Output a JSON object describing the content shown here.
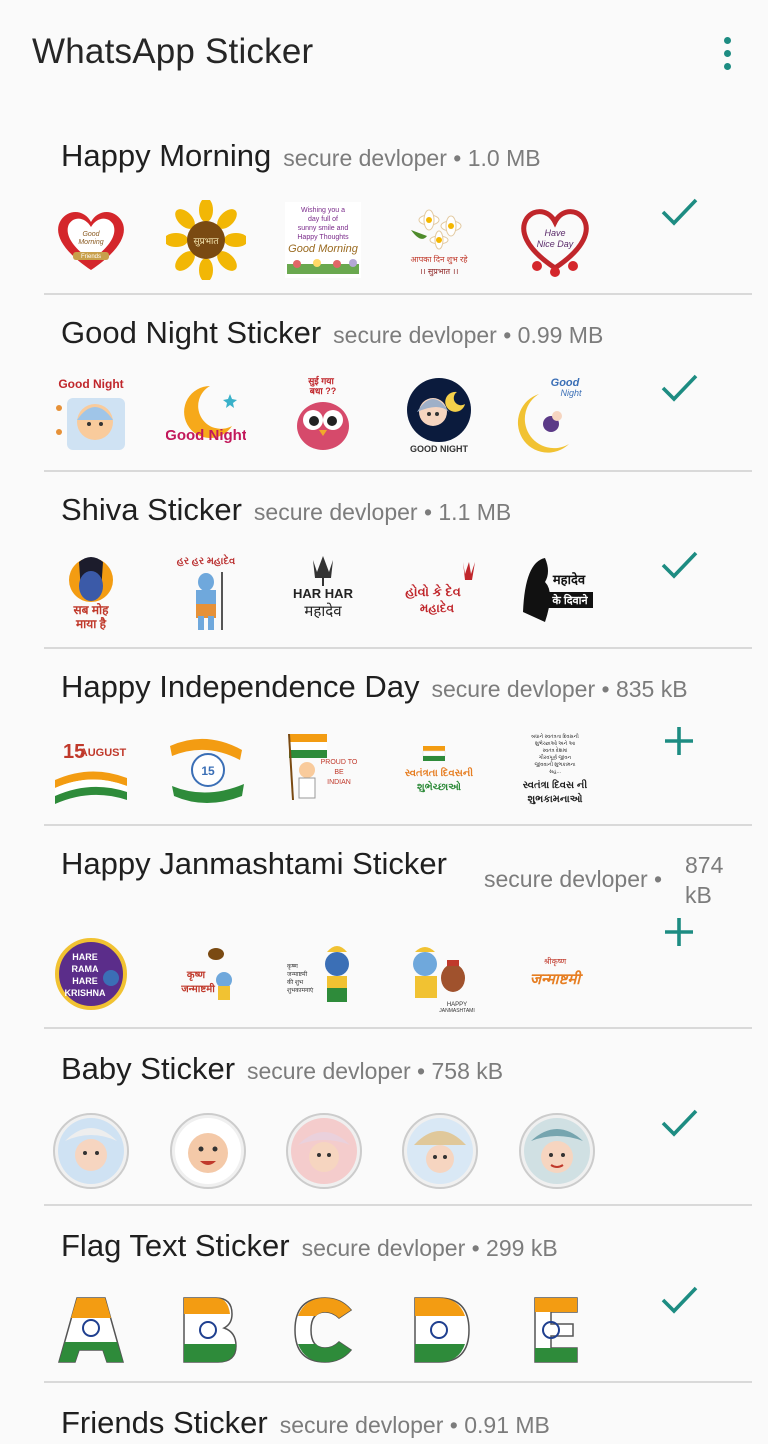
{
  "app": {
    "title": "WhatsApp Sticker"
  },
  "colors": {
    "accent": "#1d8c82",
    "divider": "#d9d9d9",
    "meta_text": "#7c7c7c"
  },
  "packs": [
    {
      "name": "Happy Morning",
      "meta": "secure devloper • 1.0 MB",
      "action": "added",
      "stickers": [
        {
          "icon": "heart-good-morning-sticker",
          "text": "Good Morning Friends"
        },
        {
          "icon": "sunflower-sticker",
          "text": "सुप्रभात"
        },
        {
          "icon": "wishing-text-sticker",
          "text": "Wishing you a day full of sunny smile and Happy Thoughts Good Morning"
        },
        {
          "icon": "flowers-sticker",
          "text": "आपका दिन शुभ रहे ।। सुप्रभात ।।"
        },
        {
          "icon": "heart-nice-day-sticker",
          "text": "Have Nice Day"
        }
      ]
    },
    {
      "name": "Good Night Sticker",
      "meta": "secure devloper • 0.99 MB",
      "action": "added",
      "stickers": [
        {
          "icon": "baby-good-night-sticker",
          "text": "Good Night"
        },
        {
          "icon": "moon-good-night-sticker",
          "text": "Good Night"
        },
        {
          "icon": "owl-sticker",
          "text": "सुई गया बधा ??"
        },
        {
          "icon": "masha-good-night-sticker",
          "text": "GOOD NIGHT"
        },
        {
          "icon": "moon-fairy-sticker",
          "text": "Good Night"
        }
      ]
    },
    {
      "name": "Shiva Sticker",
      "meta": "secure devloper • 1.1 MB",
      "action": "added",
      "stickers": [
        {
          "icon": "shiva-face-sticker",
          "text": "सब मोह माया है"
        },
        {
          "icon": "shiva-standing-sticker",
          "text": "હર હર મહાદેવ"
        },
        {
          "icon": "har-har-mahadev-sticker",
          "text": "HAR HAR महादेव"
        },
        {
          "icon": "trishul-text-sticker",
          "text": "હોવો કે દેવ મહાદેવ"
        },
        {
          "icon": "shiva-silhouette-sticker",
          "text": "महादेव के दिवाने"
        }
      ]
    },
    {
      "name": "Happy Independence Day",
      "meta": "secure devloper • 835 kB",
      "action": "add",
      "stickers": [
        {
          "icon": "15-august-sticker",
          "text": "15 AUGUST"
        },
        {
          "icon": "tricolor-15-sticker",
          "text": "15"
        },
        {
          "icon": "proud-indian-sticker",
          "text": "PROUD TO BE INDIAN"
        },
        {
          "icon": "swatantrata-sticker",
          "text": "સ્વતંત્રતા દિવસની શુભેચ્છાઓ"
        },
        {
          "icon": "gujarati-text-sticker",
          "text": "સ્વતંત્રા દિવસ ની શુભકામનાઓ"
        }
      ]
    },
    {
      "name": "Happy Janmashtami Sticker",
      "meta_part1": "secure devloper •",
      "meta_part2a": "874",
      "meta_part2b": "kB",
      "action": "add",
      "stickers": [
        {
          "icon": "hare-krishna-sticker",
          "text": "HARE RAMA HARE KRISHNA"
        },
        {
          "icon": "krishna-text-sticker",
          "text": "कृष्ण जन्माष्टमी"
        },
        {
          "icon": "krishna-wishes-sticker",
          "text": "कृष्ण जन्माष्टमी की शुभकामनाएं"
        },
        {
          "icon": "baby-krishna-sticker",
          "text": "HAPPY JANMASHTAMI"
        },
        {
          "icon": "janmashtami-title-sticker",
          "text": "जन्माष्टमी"
        }
      ]
    },
    {
      "name": "Baby Sticker",
      "meta": "secure devloper • 758 kB",
      "action": "added",
      "stickers": [
        {
          "icon": "baby-photo-sticker",
          "text": ""
        },
        {
          "icon": "baby-photo-sticker",
          "text": ""
        },
        {
          "icon": "baby-photo-sticker",
          "text": ""
        },
        {
          "icon": "baby-photo-sticker",
          "text": ""
        },
        {
          "icon": "baby-photo-sticker",
          "text": ""
        }
      ]
    },
    {
      "name": "Flag Text Sticker",
      "meta": "secure devloper • 299 kB",
      "action": "added",
      "stickers": [
        {
          "icon": "flag-letter-sticker",
          "text": "A"
        },
        {
          "icon": "flag-letter-sticker",
          "text": "B"
        },
        {
          "icon": "flag-letter-sticker",
          "text": "C"
        },
        {
          "icon": "flag-letter-sticker",
          "text": "D"
        },
        {
          "icon": "flag-letter-sticker",
          "text": "E"
        }
      ]
    },
    {
      "name": "Friends Sticker",
      "meta": "secure devloper • 0.91 MB",
      "action": "",
      "stickers": []
    }
  ]
}
